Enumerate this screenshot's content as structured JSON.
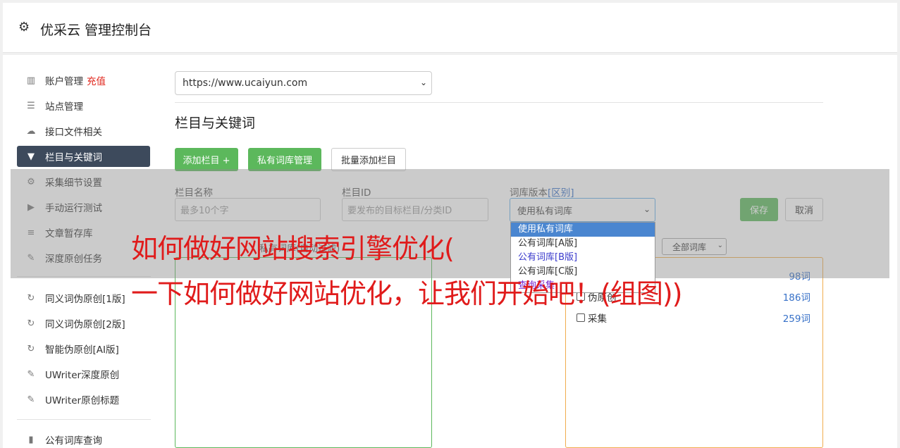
{
  "header": {
    "title": "优采云 管理控制台",
    "icon": "gear-icon"
  },
  "sidebar": {
    "items": [
      {
        "label": "账户管理",
        "extra": "充值",
        "icon": "bar-chart-icon"
      },
      {
        "label": "站点管理",
        "icon": "server-icon"
      },
      {
        "label": "接口文件相关",
        "icon": "cloud-upload-icon"
      },
      {
        "label": "栏目与关键词",
        "icon": "filter-icon",
        "active": true
      },
      {
        "label": "采集细节设置",
        "icon": "cogs-icon"
      },
      {
        "label": "手动运行测试",
        "icon": "play-circle-icon"
      },
      {
        "label": "文章暂存库",
        "icon": "database-icon"
      },
      {
        "label": "深度原创任务",
        "icon": "edit-icon"
      },
      {
        "label": "同义词伪原创[1版]",
        "icon": "refresh-icon"
      },
      {
        "label": "同义词伪原创[2版]",
        "icon": "refresh-icon"
      },
      {
        "label": "智能伪原创[AI版]",
        "icon": "refresh-icon"
      },
      {
        "label": "UWriter深度原创",
        "icon": "edit-icon"
      },
      {
        "label": "UWriter原创标题",
        "icon": "edit-icon"
      },
      {
        "label": "公有词库查询",
        "icon": "book-icon"
      }
    ]
  },
  "main": {
    "site_select_value": "https://www.ucaiyun.com",
    "section_title": "栏目与关键词",
    "buttons": {
      "add_column": "添加栏目 +",
      "private_lib": "私有词库管理",
      "batch_add": "批量添加栏目"
    },
    "form": {
      "name_label": "栏目名称",
      "name_placeholder": "最多10个字",
      "id_label": "栏目ID",
      "id_placeholder": "要发布的目标栏目/分类ID",
      "version_label": "词库版本",
      "version_label_link": "[区别]",
      "version_value": "使用私有词库",
      "save": "保存",
      "cancel": "取消"
    },
    "box_label": "私有词库(自动过滤)",
    "lib_filter_value": "全部词库",
    "lib_rows": [
      {
        "label": "",
        "count": "98词"
      },
      {
        "label": "伪原创",
        "count": "186词"
      },
      {
        "label": "采集",
        "count": "259词"
      }
    ],
    "dropdown_options": [
      "使用私有词库",
      "公有词库[A版]",
      "公有词库[B版]",
      "公有词库[C版]",
      "查询采集"
    ]
  },
  "overlay_text": {
    "line1": "如何做好网站搜索引擎优化(",
    "line2": "一下如何做好网站优化，让我们开始吧！(组图))"
  }
}
